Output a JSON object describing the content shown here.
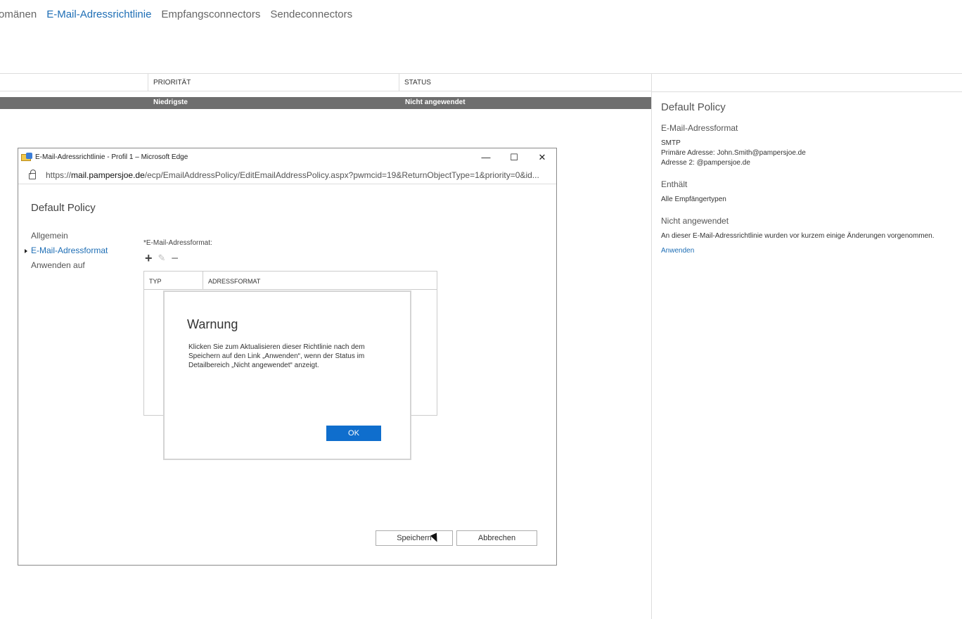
{
  "topnav": {
    "items": [
      {
        "label": "omänen"
      },
      {
        "label": "E-Mail-Adressrichtlinie"
      },
      {
        "label": "Empfangsconnectors"
      },
      {
        "label": "Sendeconnectors"
      }
    ]
  },
  "list": {
    "headers": {
      "priority": "PRIORITÄT",
      "status": "STATUS"
    },
    "rows": [
      {
        "priority": "Niedrigste",
        "status": "Nicht angewendet"
      }
    ]
  },
  "details": {
    "title": "Default Policy",
    "format_heading": "E-Mail-Adressformat",
    "format_lines": [
      "SMTP",
      "Primäre Adresse: John.Smith@pampersjoe.de",
      "Adresse 2: @pampersjoe.de"
    ],
    "contains_heading": "Enthält",
    "contains_text": "Alle Empfängertypen",
    "status_heading": "Nicht angewendet",
    "status_text": "An dieser E-Mail-Adressrichtlinie wurden vor kurzem einige Änderungen vorgenommen.",
    "apply_link": "Anwenden"
  },
  "edge_window": {
    "title": "E-Mail-Adressrichtlinie - Profil 1 – Microsoft Edge",
    "controls": {
      "minimize": "—",
      "maximize": "☐",
      "close": "✕"
    },
    "url_prefix": "https://",
    "url_host": "mail.pampersjoe.de",
    "url_path": "/ecp/EmailAddressPolicy/EditEmailAddressPolicy.aspx?pwmcid=19&ReturnObjectType=1&priority=0&id..."
  },
  "dialog": {
    "title": "Default Policy",
    "nav": [
      {
        "label": "Allgemein"
      },
      {
        "label": "E-Mail-Adressformat"
      },
      {
        "label": "Anwenden auf"
      }
    ],
    "field_label": "*E-Mail-Adressformat:",
    "toolbar": {
      "add": "+",
      "edit": "✎",
      "remove": "−"
    },
    "grid_headers": {
      "type": "TYP",
      "format": "ADRESSFORMAT"
    },
    "save_label": "Speichern",
    "cancel_label": "Abbrechen"
  },
  "warning": {
    "title": "Warnung",
    "text": "Klicken Sie zum Aktualisieren dieser Richtlinie nach dem Speichern auf den Link „Anwenden“, wenn der Status im Detailbereich „Nicht angewendet“ anzeigt.",
    "ok_label": "OK"
  }
}
